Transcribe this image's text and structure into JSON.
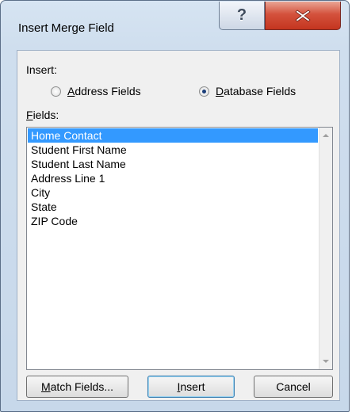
{
  "window": {
    "title": "Insert Merge Field",
    "help_glyph": "?"
  },
  "insert_group": {
    "label": "Insert:",
    "options": [
      {
        "label_accel": "A",
        "label_rest": "ddress Fields",
        "selected": false
      },
      {
        "label_accel": "D",
        "label_rest": "atabase Fields",
        "selected": true
      }
    ]
  },
  "fields": {
    "label_accel": "F",
    "label_rest": "ields:",
    "items": [
      "Home Contact",
      "Student First Name",
      "Student Last Name",
      "Address Line 1",
      "City",
      "State",
      "ZIP Code"
    ],
    "selected_index": 0
  },
  "buttons": {
    "match_fields": {
      "accel": "M",
      "rest": "atch Fields..."
    },
    "insert": {
      "accel": "I",
      "rest": "nsert"
    },
    "cancel": {
      "label": "Cancel"
    }
  },
  "colors": {
    "selection": "#3399ff",
    "close_button": "#c4351f"
  }
}
